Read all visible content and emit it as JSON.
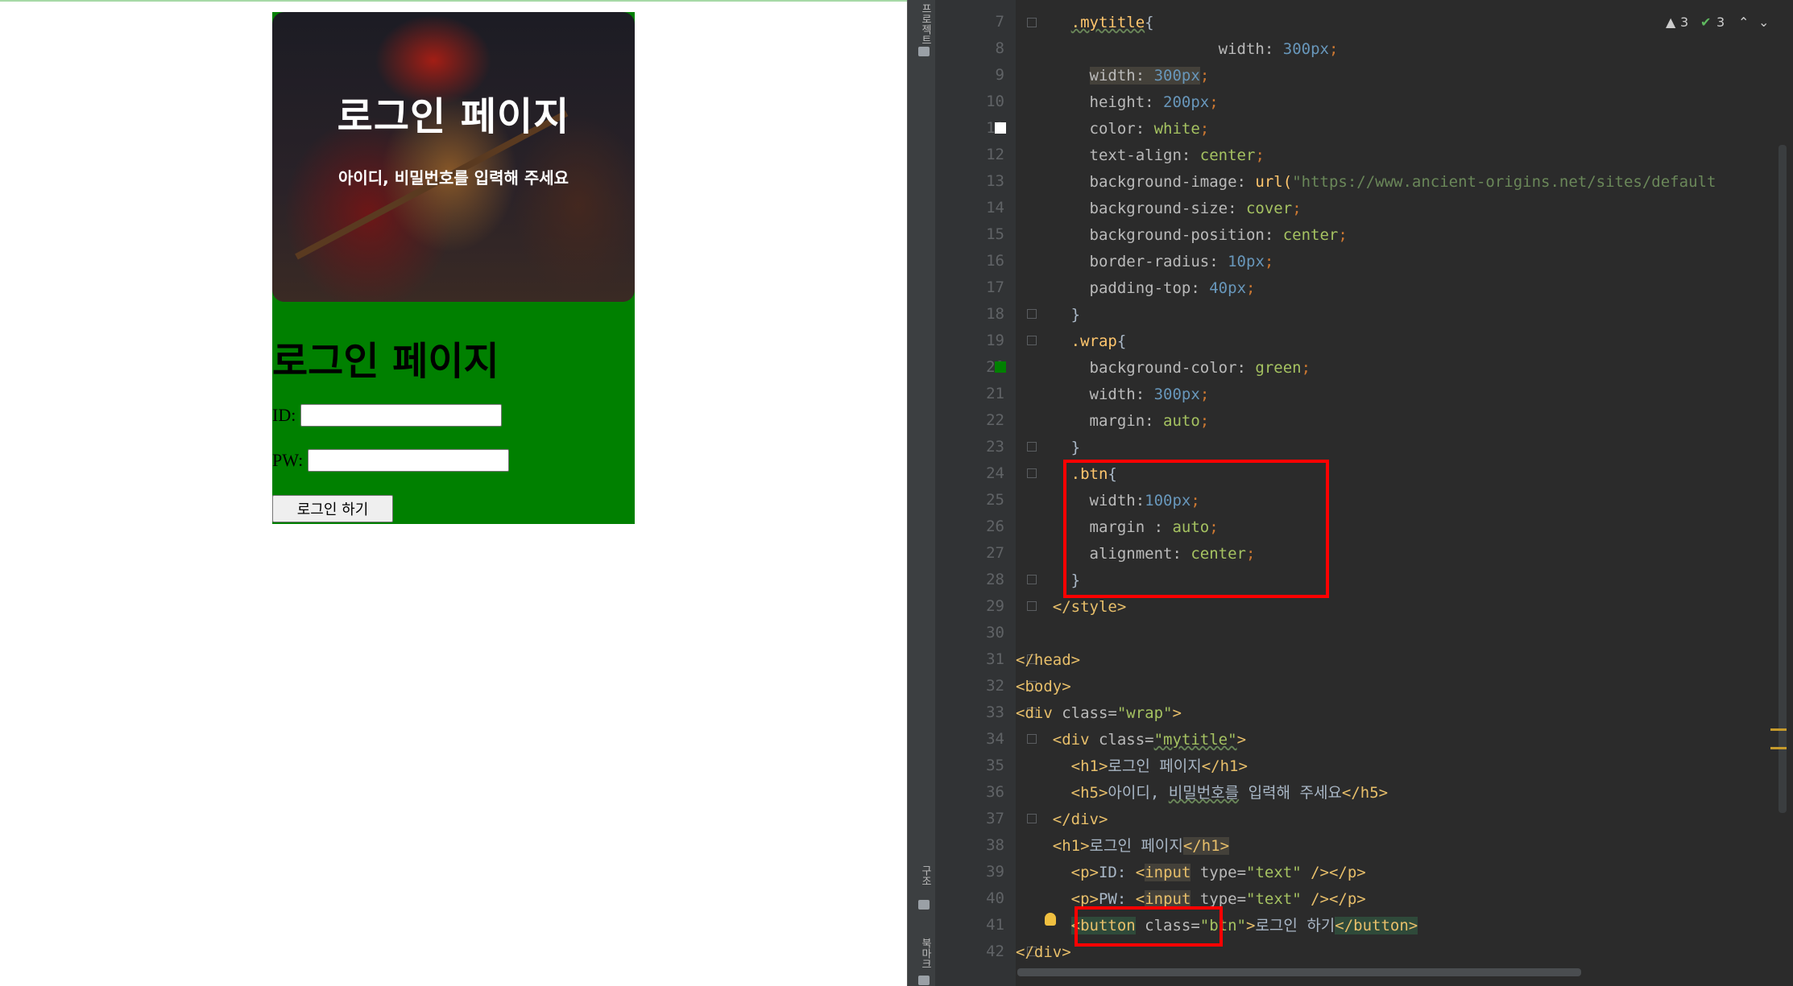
{
  "preview": {
    "title_h1": "로그인 페이지",
    "title_h5": "아이디, 비밀번호를 입력해 주세요",
    "wrap_h1": "로그인 페이지",
    "id_label": "ID:",
    "pw_label": "PW:",
    "id_value": "",
    "pw_value": "",
    "button_label": "로그인 하기",
    "colors": {
      "wrap_bg": "#008000",
      "title_text": "#ffffff"
    }
  },
  "ide": {
    "side_label_top": "프로젝트",
    "side_label_mid": "구조",
    "side_label_bottom": "북마크",
    "inspection": {
      "warnings": "3",
      "weak_warnings": "3"
    },
    "line_numbers": [
      "7",
      "8",
      "9",
      "10",
      "11",
      "12",
      "13",
      "14",
      "15",
      "16",
      "17",
      "18",
      "19",
      "20",
      "21",
      "22",
      "23",
      "24",
      "25",
      "26",
      "27",
      "28",
      "29",
      "30",
      "31",
      "32",
      "33",
      "34",
      "35",
      "36",
      "37",
      "38",
      "39",
      "40",
      "41",
      "42"
    ],
    "code": {
      "l7_sel": ".mytitle",
      "l7_brace": "{",
      "l8_prop": "width: ",
      "l8_num": "300",
      "l8_unit": "px",
      "l9_prop": "width: ",
      "l9_num": "300",
      "l9_unit": "px",
      "l10_prop": "height: ",
      "l10_num": "200",
      "l10_unit": "px",
      "l11_prop": "color: ",
      "l11_val": "white",
      "l12_prop": "text-align: ",
      "l12_val": "center",
      "l13_prop": "background-image: ",
      "l13_fn": "url(",
      "l13_str": "\"https://www.ancient-origins.net/sites/default",
      "l14_prop": "background-size: ",
      "l14_val": "cover",
      "l15_prop": "background-position: ",
      "l15_val": "center",
      "l16_prop": "border-radius: ",
      "l16_num": "10",
      "l16_unit": "px",
      "l17_prop": "padding-top: ",
      "l17_num": "40",
      "l17_unit": "px",
      "l18": "}",
      "l19_sel": ".wrap",
      "l19_brace": "{",
      "l20_prop": "background-color: ",
      "l20_val": "green",
      "l21_prop": "width: ",
      "l21_num": "300",
      "l21_unit": "px",
      "l22_prop": "margin: ",
      "l22_val": "auto",
      "l23": "}",
      "l24_sel": ".btn",
      "l24_brace": "{",
      "l25_prop": "width:",
      "l25_num": "100",
      "l25_unit": "px",
      "l26_prop": "margin : ",
      "l26_val": "auto",
      "l27_prop": "alignment: ",
      "l27_val": "center",
      "l28": "}",
      "l29": "</style>",
      "l31": "</head>",
      "l32": "<body>",
      "l33_open": "<div ",
      "l33_attr": "class=",
      "l33_str": "\"wrap\"",
      "l33_close": ">",
      "l34_open": "<div ",
      "l34_attr": "class=",
      "l34_str": "\"mytitle\"",
      "l34_close": ">",
      "l35_open": "<h1>",
      "l35_text": "로그인 페이지",
      "l35_close": "</h1>",
      "l36_open": "<h5>",
      "l36_text1": "아이디, ",
      "l36_text2": "비밀번호를",
      "l36_text3": " 입력해 주세요",
      "l36_close": "</h5>",
      "l37": "</div>",
      "l38_open": "<h1>",
      "l38_text": "로그인 페이지",
      "l38_close": "</h1>",
      "l39_p": "<p>",
      "l39_text": "ID: ",
      "l39_lt": "<",
      "l39_input": "input",
      "l39_attr": " type=",
      "l39_str": "\"text\"",
      "l39_end": " /></p>",
      "l40_p": "<p>",
      "l40_text": "PW: ",
      "l40_lt": "<",
      "l40_input": "input",
      "l40_attr": " type=",
      "l40_str": "\"text\"",
      "l40_end": " /></p>",
      "l41_open": "<button",
      "l41_attr": " class=",
      "l41_str": "\"btn\"",
      "l41_gt": ">",
      "l41_text": "로그인 하기",
      "l41_close": "</button>",
      "l42": "</div>"
    }
  }
}
